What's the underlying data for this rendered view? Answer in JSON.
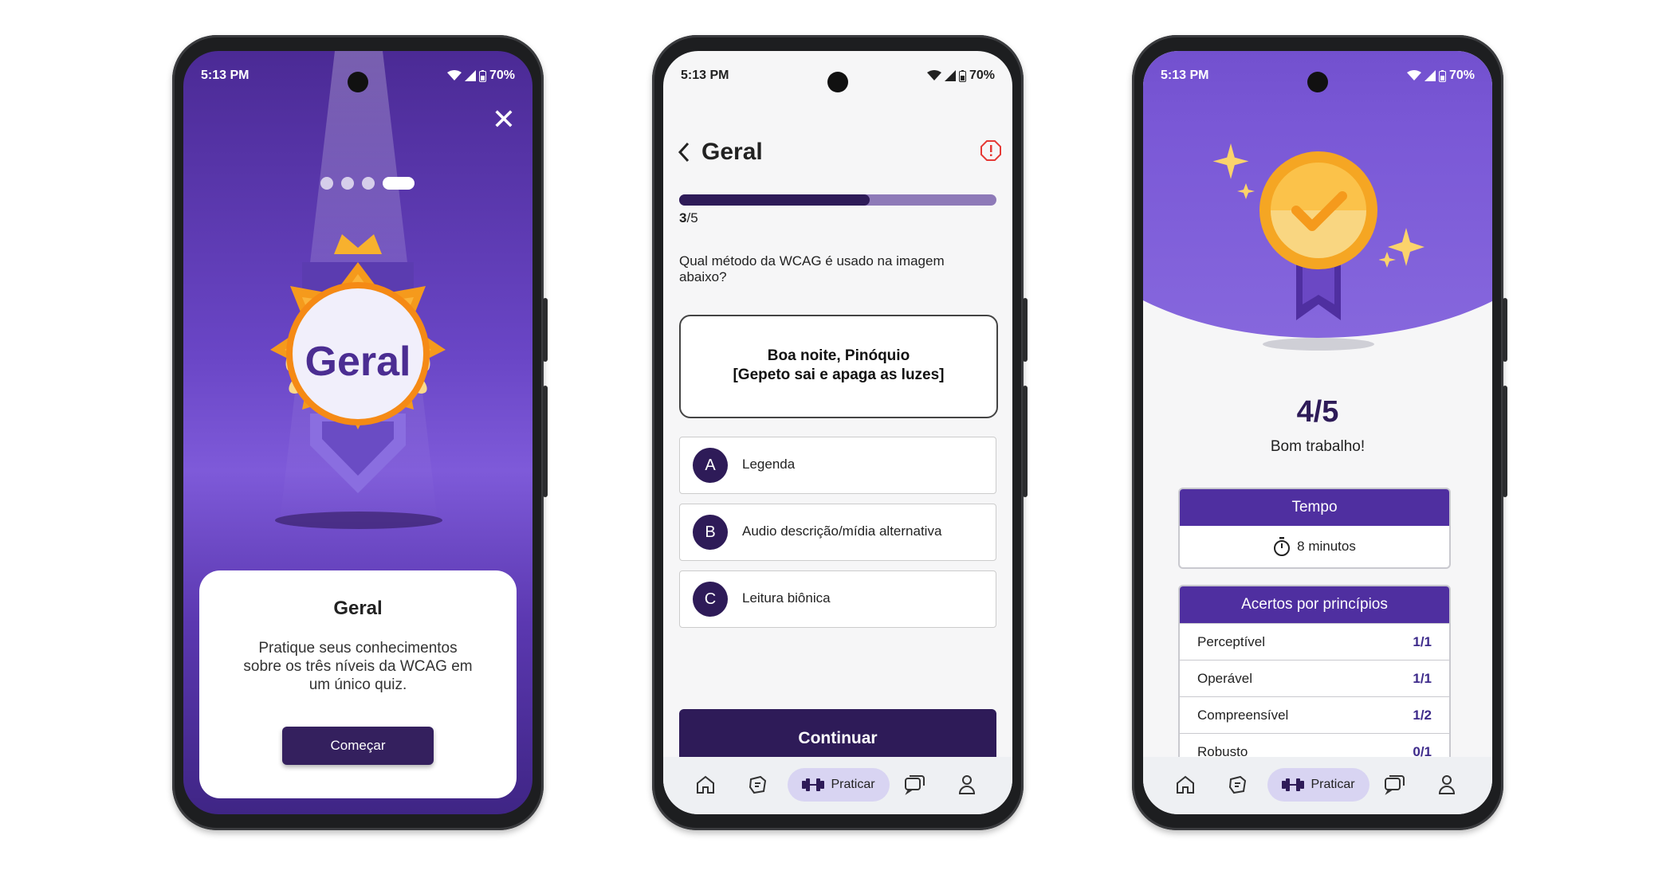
{
  "status": {
    "time": "5:13 PM",
    "battery": "70%"
  },
  "screen1": {
    "badge_title": "Geral",
    "card_title": "Geral",
    "card_text": "Pratique seus conhecimentos sobre os três níveis da WCAG em um único quiz.",
    "start_button": "Começar",
    "pagination": {
      "total": 4,
      "active": 4
    }
  },
  "screen2": {
    "title": "Geral",
    "progress": {
      "current": "3",
      "total": "/5",
      "fraction": 0.6
    },
    "question": "Qual método da WCAG é usado na imagem abaixo?",
    "quote_line1": "Boa noite, Pinóquio",
    "quote_line2": "[Gepeto sai e apaga as luzes]",
    "options": [
      {
        "letter": "A",
        "text": "Legenda"
      },
      {
        "letter": "B",
        "text": "Audio descrição/mídia alternativa"
      },
      {
        "letter": "C",
        "text": "Leitura biônica"
      }
    ],
    "continue_button": "Continuar"
  },
  "screen3": {
    "score": "4/5",
    "score_message": "Bom trabalho!",
    "time_header": "Tempo",
    "time_value": "8 minutos",
    "principles_header": "Acertos por princípios",
    "principles": [
      {
        "name": "Perceptível",
        "value": "1/1"
      },
      {
        "name": "Operável",
        "value": "1/1"
      },
      {
        "name": "Compreensível",
        "value": "1/2"
      },
      {
        "name": "Robusto",
        "value": "0/1"
      }
    ]
  },
  "navbar": {
    "active_label": "Praticar"
  },
  "colors": {
    "primary": "#2e1b58",
    "accent": "#7a58d6",
    "gold": "#f5a623"
  }
}
